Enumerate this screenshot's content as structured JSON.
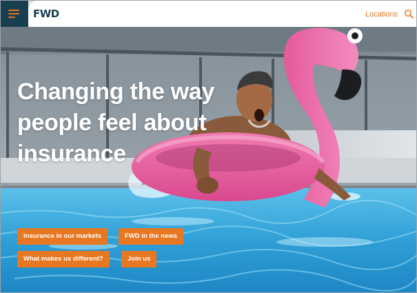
{
  "header": {
    "logo": "FWD",
    "locations_label": "Locations",
    "menu_icon": "hamburger-menu-icon",
    "search_icon": "search-icon"
  },
  "hero": {
    "headline_lines": [
      "Changing the way",
      "people feel about",
      "insurance"
    ]
  },
  "actions": {
    "insurance_markets": "Insurance in our markets",
    "fwd_news": "FWD in the news",
    "what_different": "What makes us different?",
    "join_us": "Join us"
  },
  "colors": {
    "brand_orange": "#e87722",
    "brand_navy": "#183f4f",
    "flamingo_pink": "#e85a9a",
    "pool_blue": "#3fa9dc"
  }
}
